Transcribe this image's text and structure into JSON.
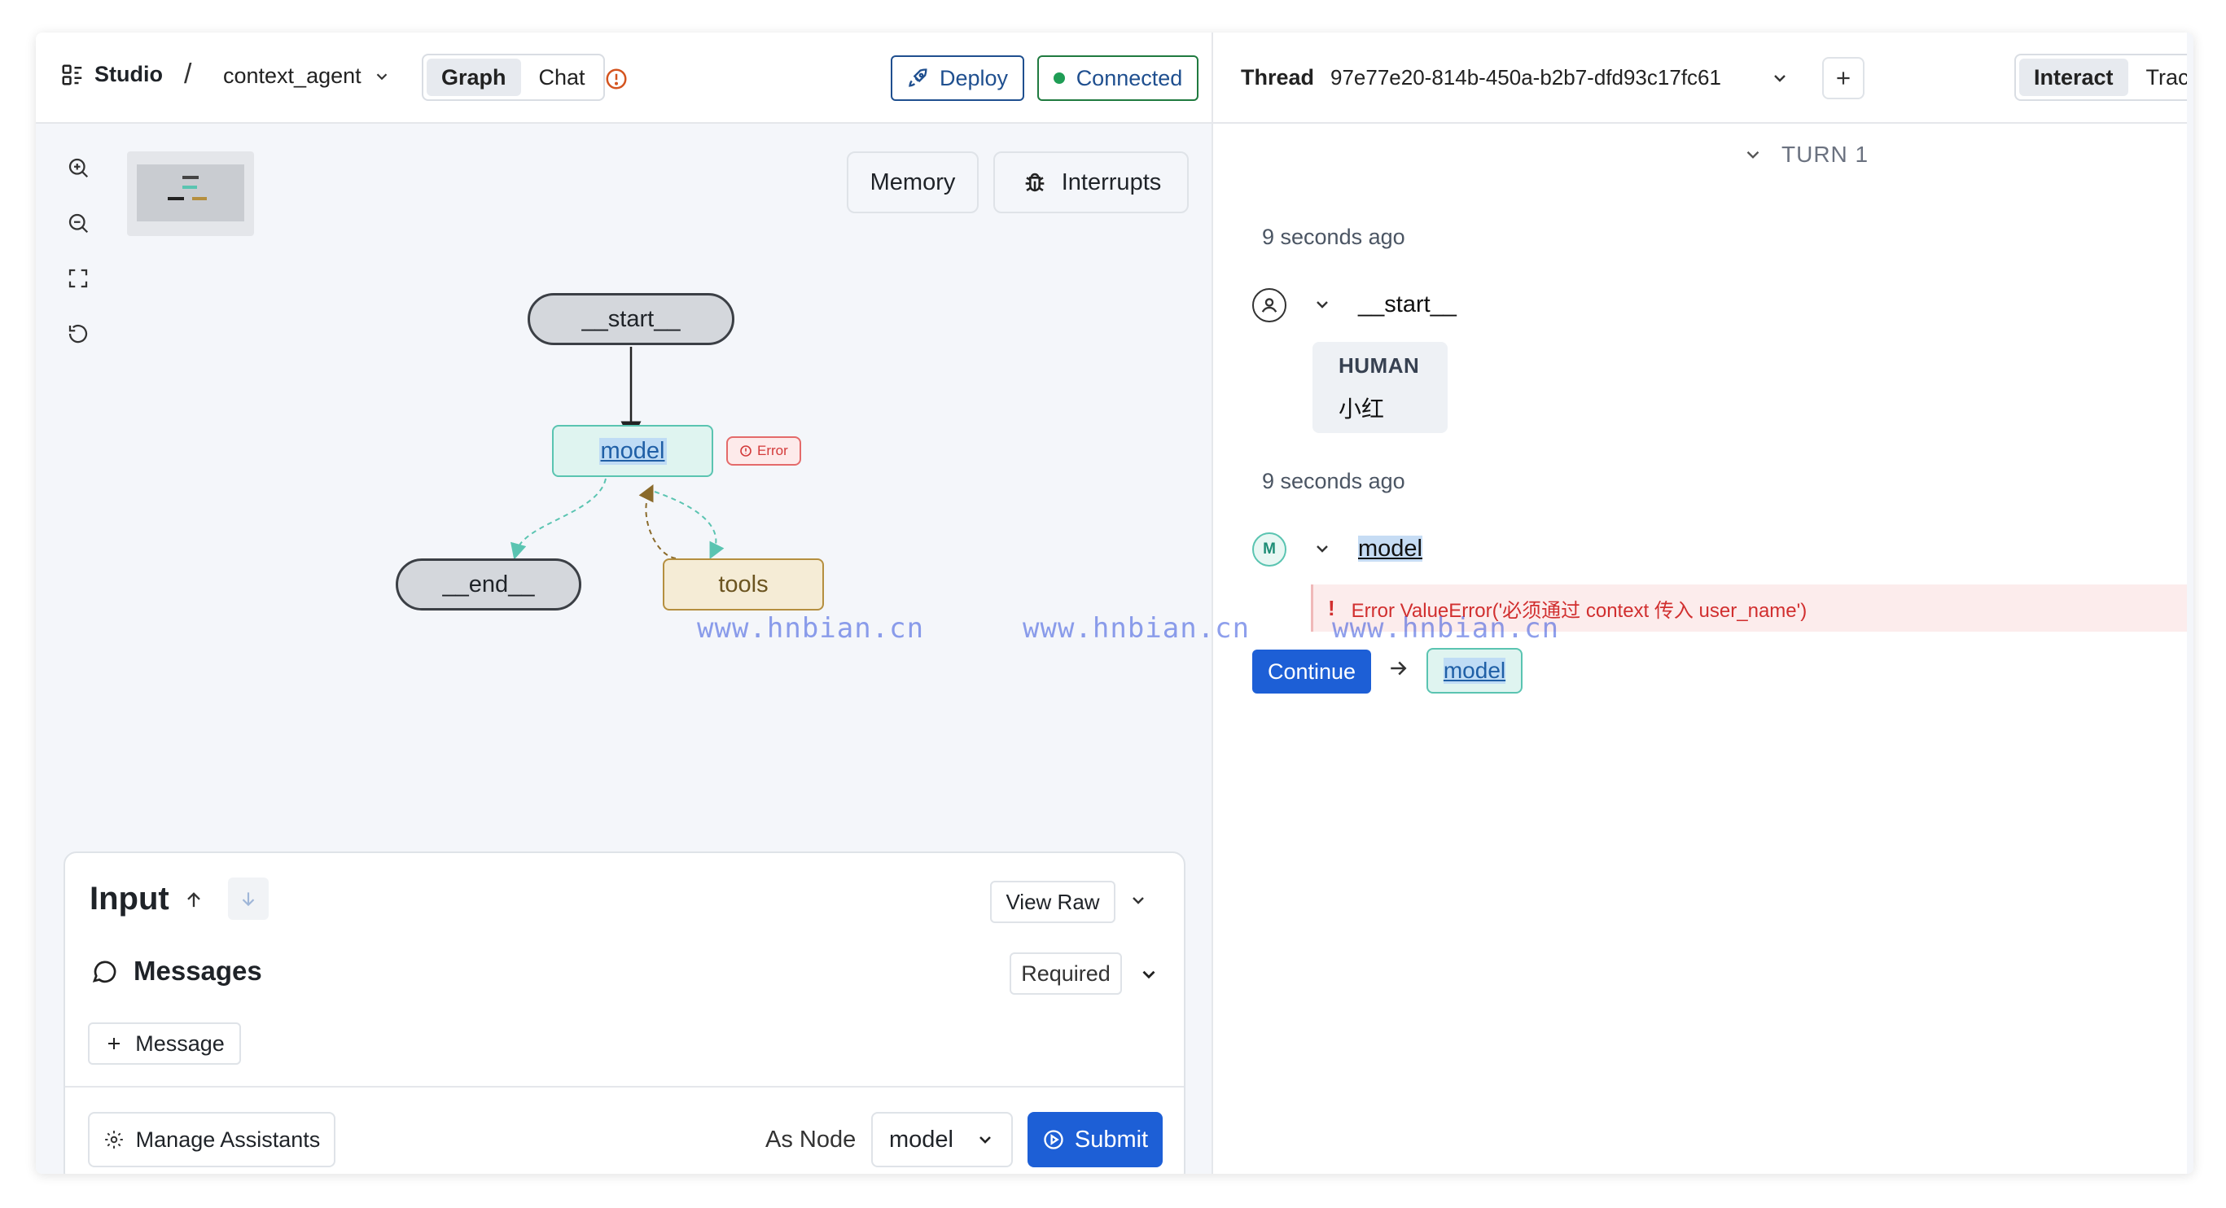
{
  "header": {
    "studio_label": "Studio",
    "separator": "/",
    "agent_name": "context_agent",
    "view_tabs": [
      "Graph",
      "Chat"
    ],
    "active_view": "Graph",
    "deploy_label": "Deploy",
    "connected_label": "Connected"
  },
  "canvas": {
    "memory_label": "Memory",
    "interrupts_label": "Interrupts",
    "nodes": {
      "start": "__start__",
      "model": "model",
      "end": "__end__",
      "tools": "tools"
    },
    "error_badge": "Error"
  },
  "watermark": "www.hnbian.cn",
  "input_panel": {
    "title": "Input",
    "view_raw_label": "View Raw",
    "messages_label": "Messages",
    "required_label": "Required",
    "add_message_label": "Message",
    "manage_assistants_label": "Manage Assistants",
    "as_node_label": "As Node",
    "as_node_value": "model",
    "submit_label": "Submit"
  },
  "thread_panel": {
    "thread_label": "Thread",
    "thread_id": "97e77e20-814b-450a-b2b7-dfd93c17fc61",
    "mode_tabs": [
      "Interact",
      "Trace"
    ],
    "active_mode": "Interact",
    "turn_label": "TURN 1",
    "steps": [
      {
        "time": "9 seconds ago",
        "node": "__start__",
        "role": "HUMAN",
        "message": "小红"
      },
      {
        "time": "9 seconds ago",
        "node": "model",
        "avatar_letter": "M",
        "error_text": "Error ValueError('必须通过 context 传入 user_name')"
      }
    ],
    "continue_label": "Continue",
    "next_node": "model"
  },
  "colors": {
    "primary_blue": "#1d5fd6",
    "success_green": "#1f9d55",
    "error_red": "#d33a3a",
    "model_node_teal": "#5ac4b1",
    "tools_node_brown": "#b58f3f"
  }
}
